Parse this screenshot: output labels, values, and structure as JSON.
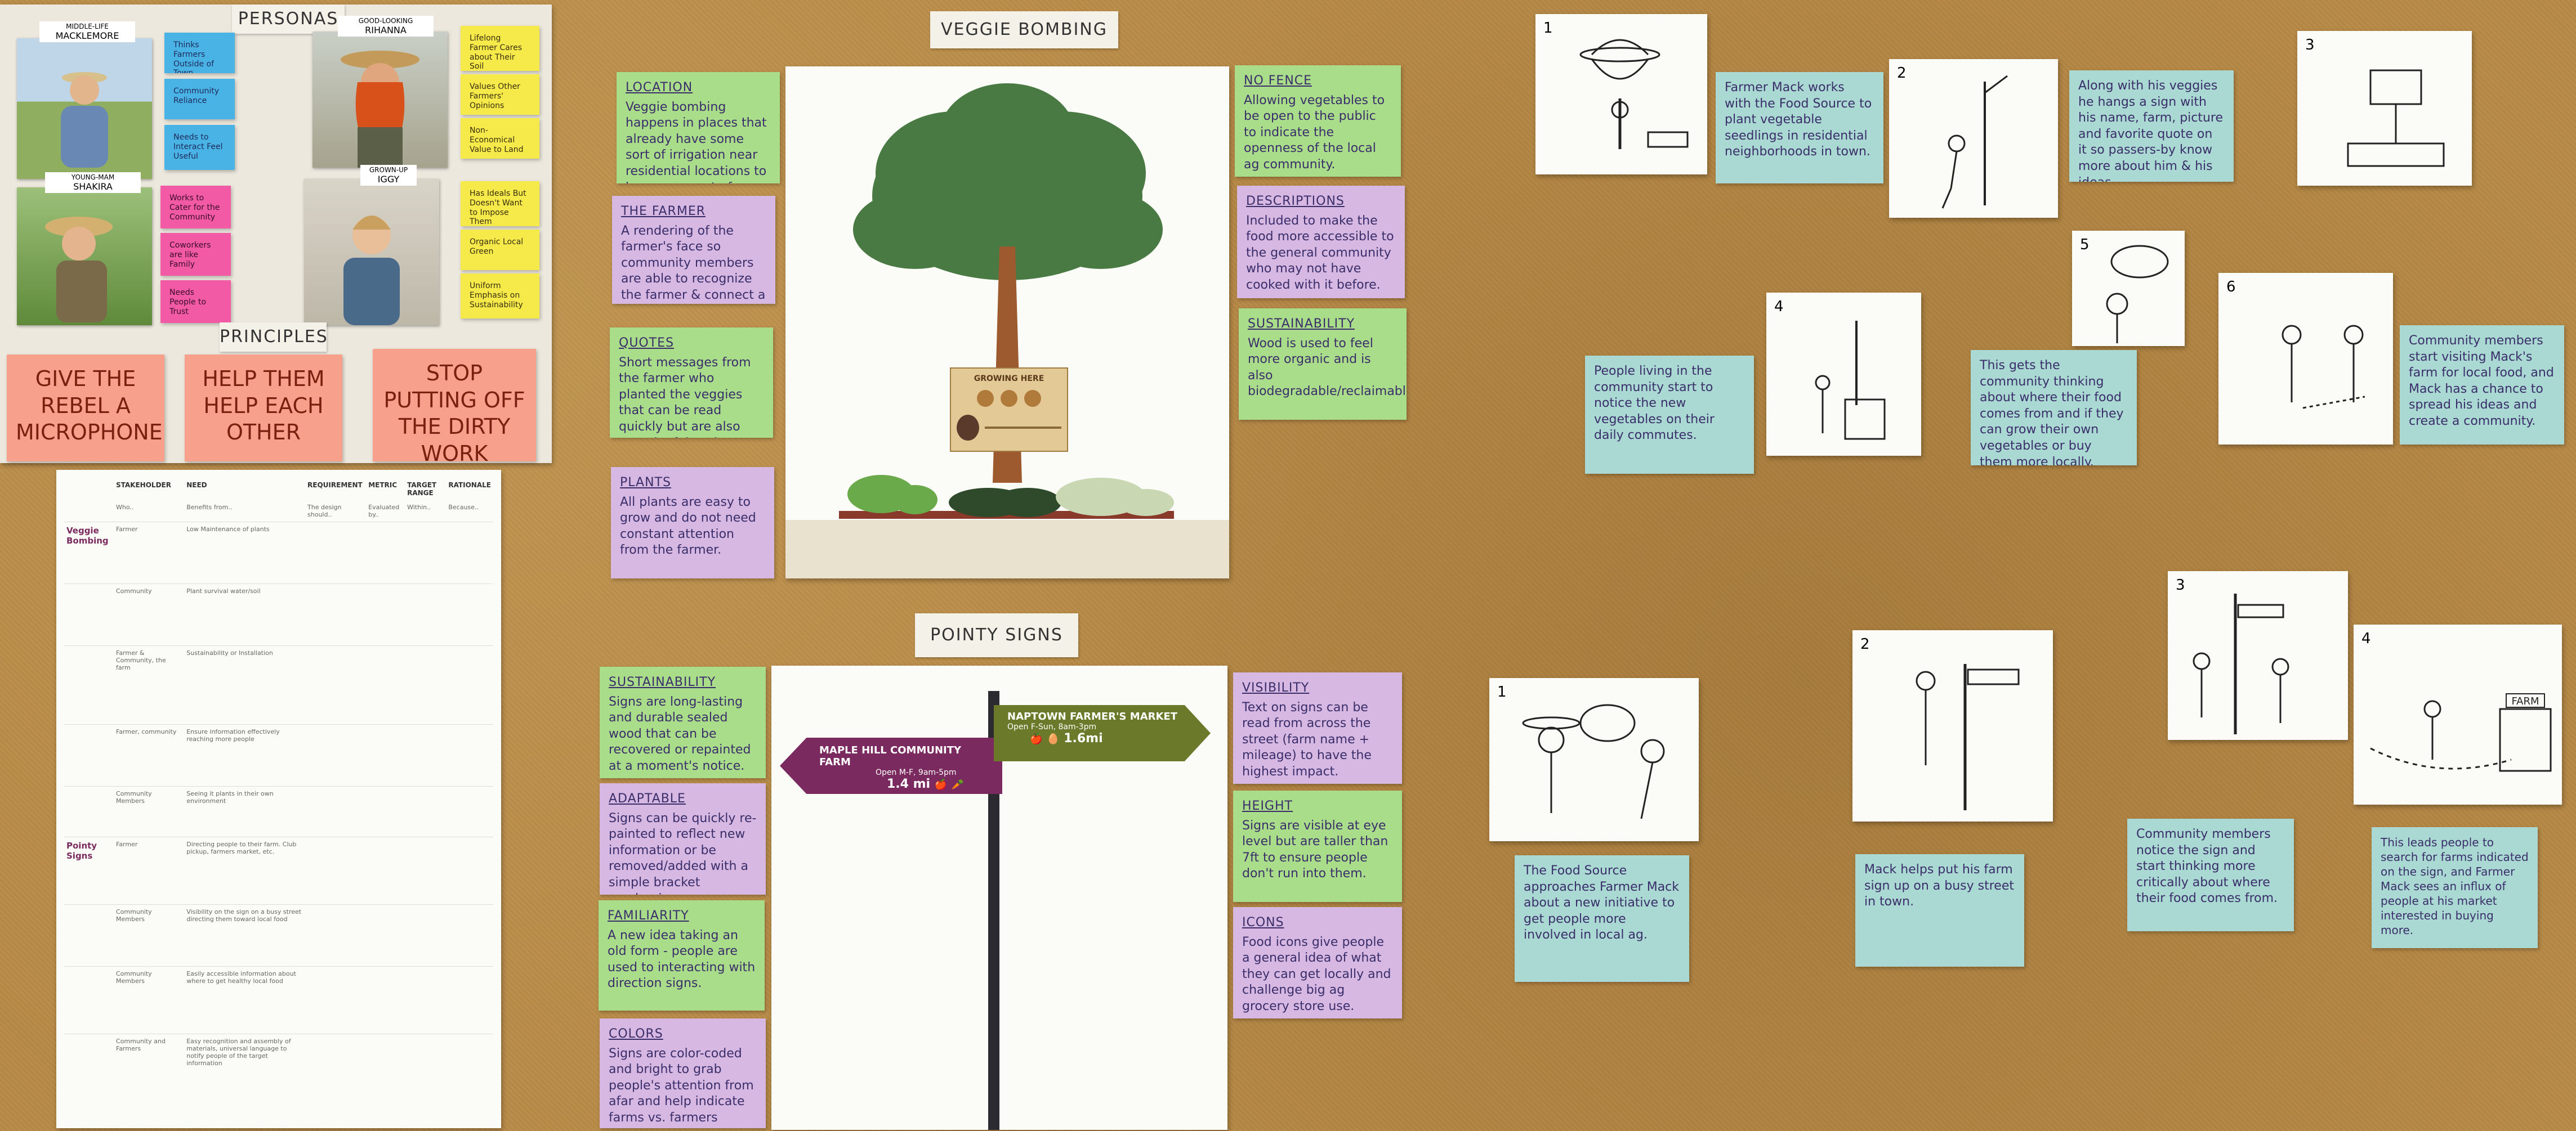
{
  "personas_board": {
    "title": "PERSONAS",
    "personas": [
      {
        "caption": "MIDDLE-LIFE",
        "name": "MACKLEMORE"
      },
      {
        "caption": "GOOD-LOOKING",
        "name": "RIHANNA"
      },
      {
        "caption": "YOUNG-MAM",
        "name": "SHAKIRA"
      },
      {
        "caption": "GROWN-UP",
        "name": "IGGY"
      }
    ],
    "notes_blue": [
      "Thinks Farmers Outside of Town",
      "Community Reliance",
      "Needs to Interact Feel Useful"
    ],
    "notes_magenta": [
      "Works to Cater for the Community",
      "Coworkers are like Family",
      "Needs People to Trust"
    ],
    "notes_yellow": [
      "Lifelong Farmer Cares about Their Soil",
      "Values Other Farmers' Opinions",
      "Non-Economical Value to Land",
      "Has Ideals But Doesn't Want to Impose Them",
      "Organic Local Green",
      "Uniform Emphasis on Sustainability"
    ],
    "principles_title": "PRINCIPLES",
    "principles": [
      "GIVE THE REBEL A MICROPHONE",
      "HELP THEM HELP EACH OTHER",
      "STOP PUTTING OFF THE DIRTY WORK"
    ]
  },
  "requirements_table": {
    "headers": [
      "STAKEHOLDER",
      "NEED",
      "REQUIREMENT",
      "METRIC",
      "TARGET RANGE",
      "RATIONALE"
    ],
    "subheaders": [
      "Who..",
      "Benefits from..",
      "The design should..",
      "Evaluated by..",
      "Within..",
      "Because.."
    ],
    "groups": [
      "Veggie Bombing",
      "Pointy Signs"
    ],
    "rows": [
      {
        "stakeholder": "Farmer",
        "need": "Low Maintenance of plants"
      },
      {
        "stakeholder": "Community",
        "need": "Plant survival water/soil"
      },
      {
        "stakeholder": "Farmer & Community, the farm",
        "need": "Sustainability or Installation"
      },
      {
        "stakeholder": "Farmer, community",
        "need": "Ensure information effectively reaching more people"
      },
      {
        "stakeholder": "Community Members",
        "need": "Seeing it plants in their own environment"
      },
      {
        "stakeholder": "Farmer",
        "need": "Directing people to their farm. Club pickup, farmers market, etc."
      },
      {
        "stakeholder": "Community Members",
        "need": "Visibility on the sign on a busy street directing them toward local food"
      },
      {
        "stakeholder": "Community Members",
        "need": "Easily accessible information about where to get healthy local food"
      },
      {
        "stakeholder": "Community and Farmers",
        "need": "Easy recognition and assembly of materials, universal language to notify people of the target information"
      }
    ]
  },
  "veggie_bombing": {
    "title": "VEGGIE BOMBING",
    "sign_title": "GROWING HERE",
    "notes_left": [
      {
        "title": "LOCATION",
        "body": "Veggie bombing happens in places that already have some sort of irrigation near residential locations to become a part of people's daily lives."
      },
      {
        "title": "THE FARMER",
        "body": "A rendering of the farmer's face so community members are able to recognize the farmer & connect a face with an idea/name."
      },
      {
        "title": "QUOTES",
        "body": "Short messages from the farmer who planted the veggies that can be read quickly but are also meaningful to the farmer."
      },
      {
        "title": "PLANTS",
        "body": "All plants are easy to grow and do not need constant attention from the farmer."
      }
    ],
    "notes_right": [
      {
        "title": "NO FENCE",
        "body": "Allowing vegetables to be open to the public to indicate the openness of the local ag community."
      },
      {
        "title": "DESCRIPTIONS",
        "body": "Included to make the food more accessible to the general community who may not have cooked with it before."
      },
      {
        "title": "SUSTAINABILITY",
        "body": "Wood is used to feel more organic and is also biodegradable/reclaimable."
      }
    ]
  },
  "pointy_signs": {
    "title": "POINTY SIGNS",
    "sign_left": {
      "name": "MAPLE HILL COMMUNITY FARM",
      "hours": "Open M-F, 9am-5pm",
      "distance": "1.4 mi"
    },
    "sign_right": {
      "name": "NAPTOWN FARMER'S MARKET",
      "hours": "Open F-Sun, 8am-3pm",
      "distance": "1.6mi"
    },
    "notes_left": [
      {
        "title": "SUSTAINABILITY",
        "body": "Signs are long-lasting and durable sealed wood that can be recovered or repainted at a moment's notice."
      },
      {
        "title": "ADAPTABLE",
        "body": "Signs can be quickly re-painted to reflect new information or be removed/added with a simple bracket mechanism."
      },
      {
        "title": "FAMILIARITY",
        "body": "A new idea taking an old form - people are used to interacting with direction signs."
      },
      {
        "title": "COLORS",
        "body": "Signs are color-coded and bright to grab people's attention from afar and help indicate farms vs. farmers markets."
      }
    ],
    "notes_right": [
      {
        "title": "VISIBILITY",
        "body": "Text on signs can be read from across the street (farm name + mileage) to have the highest impact."
      },
      {
        "title": "HEIGHT",
        "body": "Signs are visible at eye level but are taller than 7ft to ensure people don't run into them."
      },
      {
        "title": "ICONS",
        "body": "Food icons give people a general idea of what they can get locally and challenge big ag grocery store use."
      }
    ]
  },
  "storyboard_top": {
    "frames": [
      "1",
      "2",
      "3",
      "4",
      "5",
      "6"
    ],
    "captions": [
      "Farmer Mack works with the Food Source to plant vegetable seedlings in residential neighborhoods in town.",
      "Along with his veggies he hangs a sign with his name, farm, picture and favorite quote on it so passers-by know more about him & his ideas.",
      "People living in the community start to notice the new vegetables on their daily commutes.",
      "This gets the community thinking about where their food comes from and if they can grow their own vegetables or buy them more locally.",
      "Community members start visiting Mack's farm for local food, and Mack has a chance to spread his ideas and create a community."
    ]
  },
  "storyboard_bottom": {
    "frames": [
      "1",
      "2",
      "3",
      "4"
    ],
    "sign_label": "FARM",
    "captions": [
      "The Food Source approaches Farmer Mack about a new initiative to get people more involved in local ag.",
      "Mack helps put his farm sign up on a busy street in town.",
      "Community members notice the sign and start thinking more critically about where their food comes from.",
      "This leads people to search for farms indicated on the sign, and Farmer Mack sees an influx of people at his market interested in buying more."
    ]
  },
  "colors": {
    "cork": "#b88a46",
    "green_note": "#a9dd8a",
    "purple_note": "#d6b8e2",
    "teal_note": "#a9d9d2",
    "pink_note": "#f7a08c",
    "sign_green": "#6b7a2a",
    "sign_purple": "#7a2a5e"
  }
}
